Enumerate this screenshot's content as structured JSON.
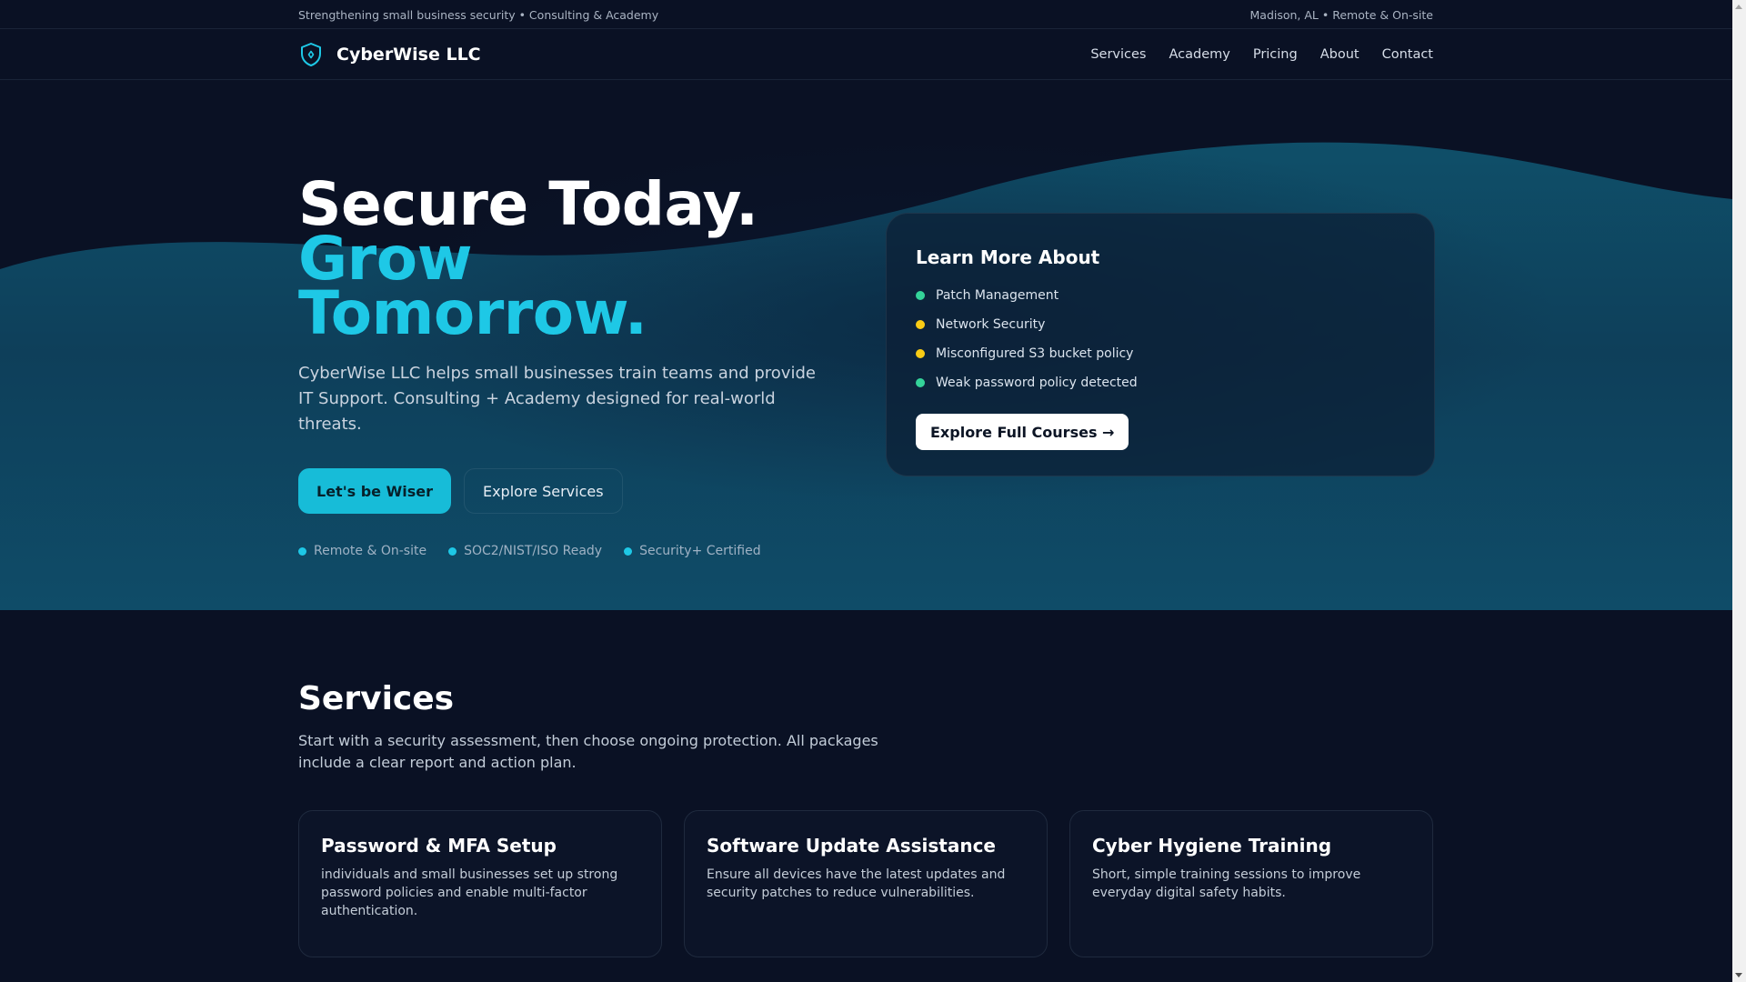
{
  "topbar": {
    "left": "Strengthening small business security • Consulting & Academy",
    "right": "Madison, AL • Remote & On-site"
  },
  "brand": {
    "name": "CyberWise LLC",
    "icon": "shield-icon"
  },
  "nav": [
    "Services",
    "Academy",
    "Pricing",
    "About",
    "Contact"
  ],
  "hero": {
    "headline_line1": "Secure Today.",
    "headline_line2": "Grow Tomorrow.",
    "lead": "CyberWise LLC helps small businesses train teams and provide IT Support. Consulting + Academy designed for real-world threats.",
    "primary_cta": "Let's be Wiser",
    "secondary_cta": "Explore Services",
    "badges": [
      "Remote & On-site",
      "SOC2/NIST/ISO Ready",
      "Security+ Certified"
    ]
  },
  "learn_card": {
    "title": "Learn More About",
    "items": [
      {
        "label": "Patch Management",
        "color": "#34d399"
      },
      {
        "label": "Network Security",
        "color": "#facc15"
      },
      {
        "label": "Misconfigured S3 bucket policy",
        "color": "#facc15"
      },
      {
        "label": "Weak password policy detected",
        "color": "#34d399"
      }
    ],
    "cta": "Explore Full Courses →"
  },
  "services": {
    "title": "Services",
    "lead": "Start with a security assessment, then choose ongoing protection. All packages include a clear report and action plan.",
    "cards": [
      {
        "title": "Password & MFA Setup",
        "desc": "individuals and small businesses set up strong password policies and enable multi-factor authentication."
      },
      {
        "title": "Software Update Assistance",
        "desc": "Ensure all devices have the latest updates and security patches to reduce vulnerabilities."
      },
      {
        "title": "Cyber Hygiene Training",
        "desc": "Short, simple training sessions to improve everyday digital safety habits."
      }
    ]
  },
  "colors": {
    "accent": "#1ec8e6",
    "background": "#0a1124",
    "wave": "#0f4a63"
  }
}
